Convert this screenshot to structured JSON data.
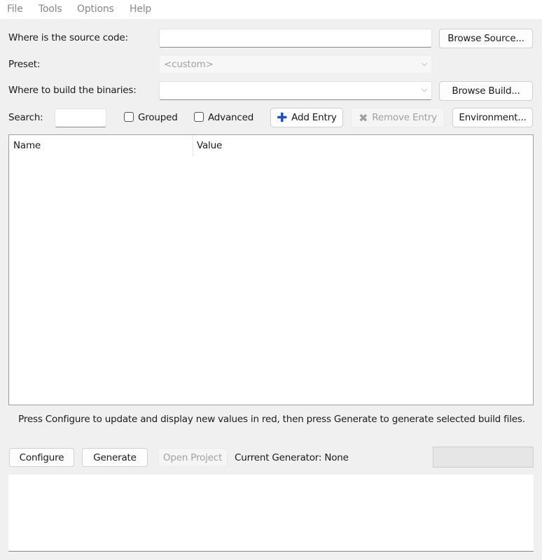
{
  "menu": [
    "File",
    "Tools",
    "Options",
    "Help"
  ],
  "source": {
    "label": "Where is the source code:",
    "value": "",
    "browse": "Browse Source..."
  },
  "preset": {
    "label": "Preset:",
    "value": "<custom>"
  },
  "build": {
    "label": "Where to build the binaries:",
    "value": "",
    "browse": "Browse Build..."
  },
  "toolbar": {
    "search_label": "Search:",
    "search_value": "",
    "grouped": "Grouped",
    "advanced": "Advanced",
    "add_entry": "Add Entry",
    "remove_entry": "Remove Entry",
    "environment": "Environment..."
  },
  "table": {
    "columns": [
      "Name",
      "Value"
    ],
    "rows": []
  },
  "hint": "Press Configure to update and display new values in red, then press Generate to generate selected build files.",
  "actions": {
    "configure": "Configure",
    "generate": "Generate",
    "open_project": "Open Project",
    "generator": "Current Generator: None"
  },
  "colors": {
    "add_icon": "#1f4fbf",
    "disabled": "#a0a0a0"
  }
}
